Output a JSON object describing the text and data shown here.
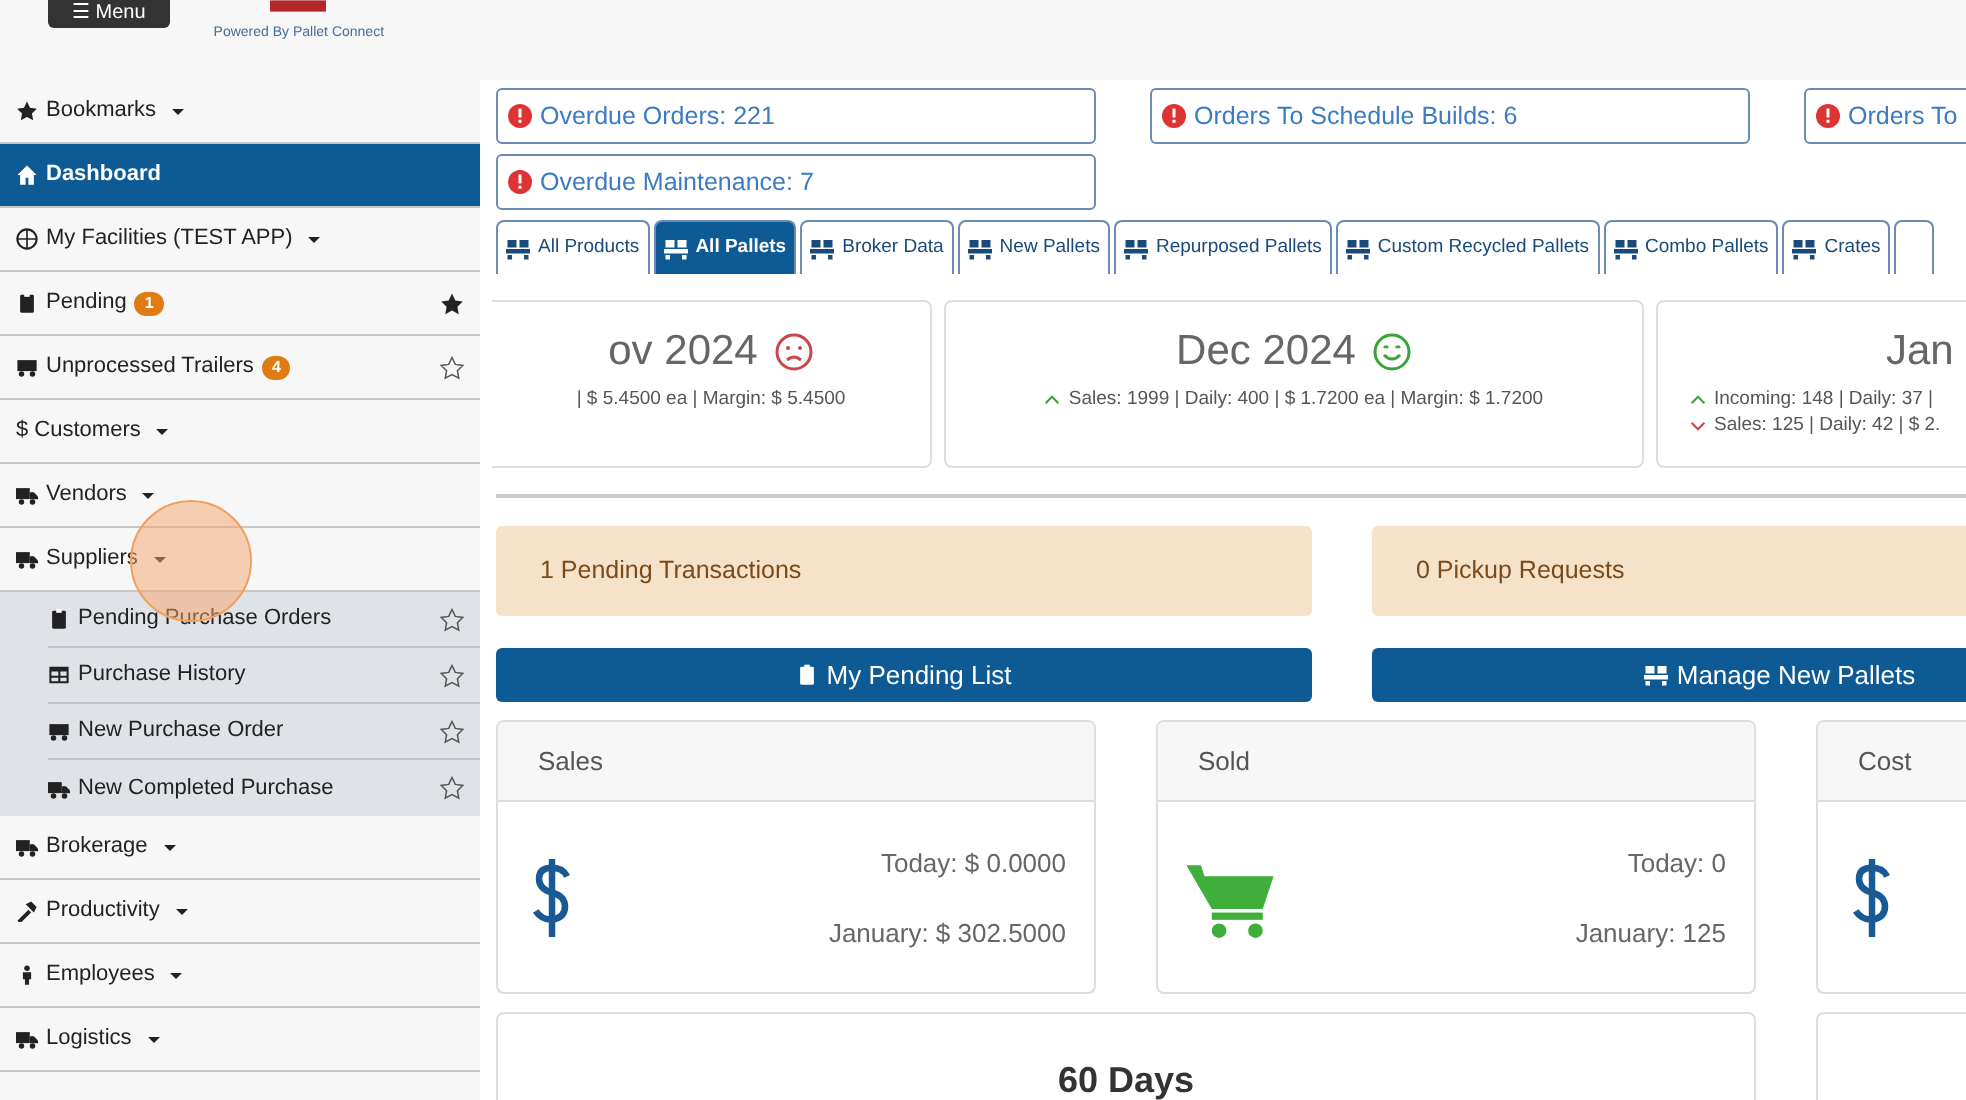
{
  "header": {
    "menu_button": "☰ Menu",
    "powered_by": "Powered By Pallet Connect"
  },
  "sidebar": {
    "items": [
      {
        "label": "Bookmarks",
        "dropdown": true,
        "selected": false
      },
      {
        "label": "Dashboard",
        "dropdown": false,
        "selected": true
      },
      {
        "label": "My Facilities (TEST APP)",
        "dropdown": true,
        "selected": false
      },
      {
        "label": "Pending",
        "badge": "1",
        "dropdown": false,
        "selected": false,
        "bookmarked": true
      },
      {
        "label": "Unprocessed Trailers",
        "badge": "4",
        "dropdown": false,
        "selected": false,
        "bookmarked": false
      },
      {
        "label": "$ Customers",
        "dropdown": true,
        "selected": false
      },
      {
        "label": "Vendors",
        "dropdown": true,
        "selected": false
      },
      {
        "label": "Suppliers",
        "dropdown": true,
        "selected": false,
        "expanded": true,
        "children": [
          {
            "label": "Pending Purchase Orders",
            "bookmarked": false
          },
          {
            "label": "Purchase History",
            "bookmarked": false
          },
          {
            "label": "New Purchase Order",
            "bookmarked": false
          },
          {
            "label": "New Completed Purchase",
            "bookmarked": false
          }
        ]
      },
      {
        "label": "Brokerage",
        "dropdown": true,
        "selected": false
      },
      {
        "label": "Productivity",
        "dropdown": true,
        "selected": false
      },
      {
        "label": "Employees",
        "dropdown": true,
        "selected": false
      },
      {
        "label": "Logistics",
        "dropdown": true,
        "selected": false
      }
    ]
  },
  "alerts": [
    "Overdue Orders: 221",
    "Orders To Schedule Builds: 6",
    "Orders To",
    "Overdue Maintenance: 7"
  ],
  "tabs": [
    {
      "label": "All Products",
      "selected": false
    },
    {
      "label": "All Pallets",
      "selected": true
    },
    {
      "label": "Broker Data",
      "selected": false
    },
    {
      "label": "New Pallets",
      "selected": false
    },
    {
      "label": "Repurposed Pallets",
      "selected": false
    },
    {
      "label": "Custom Recycled Pallets",
      "selected": false
    },
    {
      "label": "Combo Pallets",
      "selected": false
    },
    {
      "label": "Crates",
      "selected": false
    }
  ],
  "months": [
    {
      "title": "ov 2024",
      "kind": "sad",
      "lines": [
        {
          "kind": "plain",
          "text": "| $ 5.4500 ea | Margin: $ 5.4500"
        }
      ]
    },
    {
      "title": "Dec 2024",
      "kind": "happy",
      "lines": [
        {
          "kind": "up",
          "text": "Sales: 1999 | Daily: 400 | $ 1.7200 ea | Margin: $ 1.7200"
        }
      ]
    },
    {
      "title": "Jan",
      "kind": "plain",
      "lines": [
        {
          "kind": "up",
          "text": "Incoming: 148 | Daily: 37 |"
        },
        {
          "kind": "down",
          "text": "Sales: 125 | Daily: 42 | $ 2."
        }
      ]
    }
  ],
  "notices": [
    "1 Pending Transactions",
    "0 Pickup Requests"
  ],
  "actions": [
    "My Pending List",
    "Manage New Pallets"
  ],
  "stats": [
    {
      "title": "Sales",
      "kind": "dollar",
      "today": "Today: $ 0.0000",
      "month": "January: $ 302.5000"
    },
    {
      "title": "Sold",
      "kind": "cart",
      "today": "Today: 0",
      "month": "January: 125"
    },
    {
      "title": "Cost",
      "kind": "dollar"
    }
  ],
  "period_title": "60 Days"
}
